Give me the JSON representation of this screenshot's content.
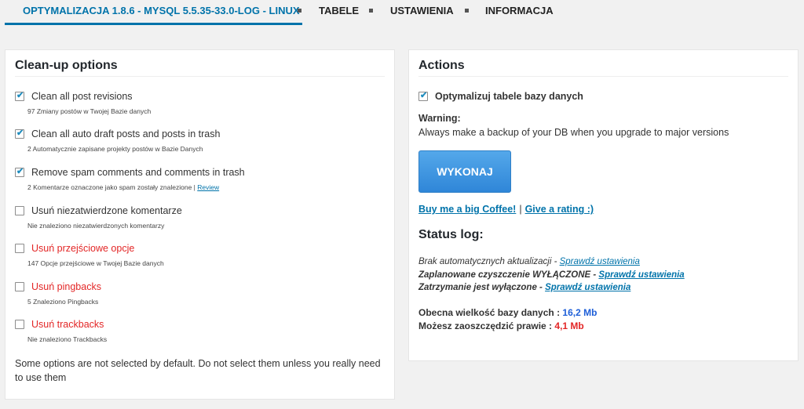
{
  "tabs": [
    {
      "label": "OPTYMALIZACJA 1.8.6 - MYSQL 5.5.35-33.0-LOG - LINUX",
      "active": true
    },
    {
      "label": "TABELE",
      "active": false
    },
    {
      "label": "USTAWIENIA",
      "active": false
    },
    {
      "label": "INFORMACJA",
      "active": false
    }
  ],
  "cleanup": {
    "title": "Clean-up options",
    "options": [
      {
        "label": "Clean all post revisions",
        "desc": "97 Zmiany postów w Twojej Bazie danych",
        "checked": true
      },
      {
        "label": "Clean all auto draft posts and posts in trash",
        "desc": "2 Automatycznie zapisane projekty postów w Bazie Danych",
        "checked": true
      },
      {
        "label": "Remove spam comments and comments in trash",
        "desc": "2 Komentarze oznaczone jako spam zostały znalezione |",
        "desc_link": "Review",
        "checked": true
      },
      {
        "label": "Usuń niezatwierdzone komentarze",
        "desc": "Nie znaleziono niezatwierdzonych komentarzy",
        "checked": false
      },
      {
        "label": "Usuń przejściowe opcje",
        "desc": "147 Opcje przejściowe w Twojej Bazie danych",
        "checked": false
      },
      {
        "label": "Usuń pingbacks",
        "desc": "5 Znaleziono Pingbacks",
        "checked": false
      },
      {
        "label": "Usuń trackbacks",
        "desc": "Nie znaleziono Trackbacks",
        "checked": false
      }
    ],
    "note": "Some options are not selected by default. Do not select them unless you really need to use them"
  },
  "actions": {
    "title": "Actions",
    "optimize_label": "Optymalizuj tabele bazy danych",
    "optimize_checked": true,
    "warning_title": "Warning:",
    "warning_text": "Always make a backup of your DB when you upgrade to major versions",
    "button_label": "WYKONAJ",
    "coffee_link": "Buy me a big Coffee!",
    "separator": "|",
    "rating_link": "Give a rating :)",
    "status_title": "Status log:",
    "status_lines": [
      {
        "text": "Brak automatycznych aktualizacji -",
        "link": "Sprawdź ustawienia"
      },
      {
        "text": "Zaplanowane czyszczenie WYŁĄCZONE -",
        "link": "Sprawdź ustawienia"
      },
      {
        "text": "Zatrzymanie jest wyłączone -",
        "link": "Sprawdź ustawienia"
      }
    ],
    "db_size_label": "Obecna wielkość bazy danych :",
    "db_size_value": "16,2 Mb",
    "save_label": "Możesz zaoszczędzić prawie :",
    "save_value": "4,1 Mb"
  },
  "colors": {
    "accent": "#0073aa",
    "danger": "#e32626",
    "size_blue": "#1e5fd8"
  }
}
